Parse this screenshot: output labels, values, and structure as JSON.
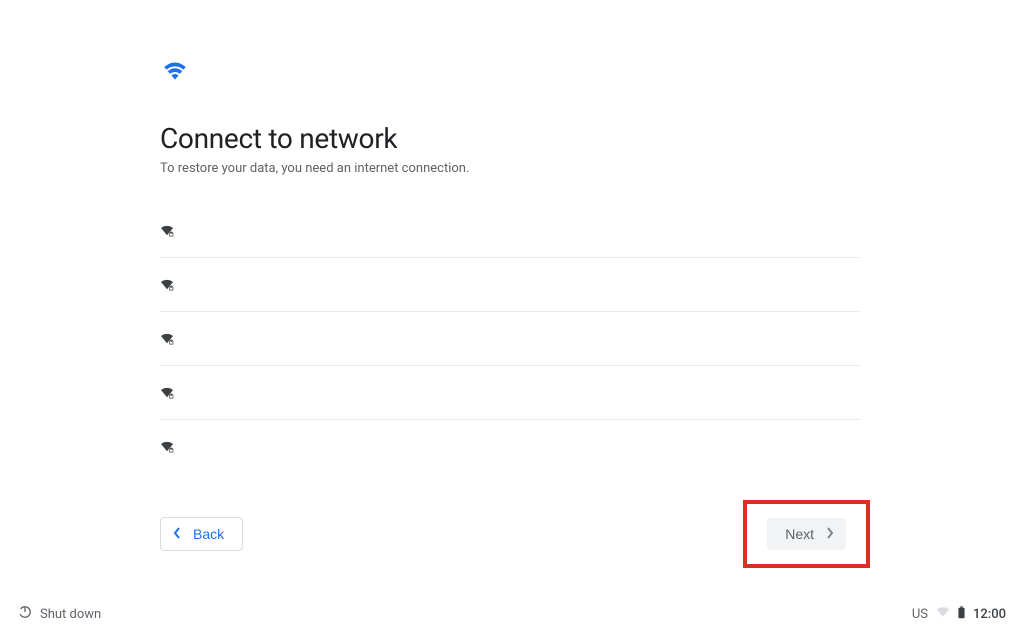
{
  "header": {
    "title": "Connect to network",
    "subtitle": "To restore your data, you need an internet connection."
  },
  "networks": {
    "items": [
      {
        "name": ""
      },
      {
        "name": ""
      },
      {
        "name": ""
      },
      {
        "name": ""
      },
      {
        "name": ""
      }
    ]
  },
  "add_network": {
    "label": ""
  },
  "buttons": {
    "back": "Back",
    "next": "Next"
  },
  "system": {
    "shutdown": "Shut down",
    "ime": "US",
    "time": "12:00"
  }
}
